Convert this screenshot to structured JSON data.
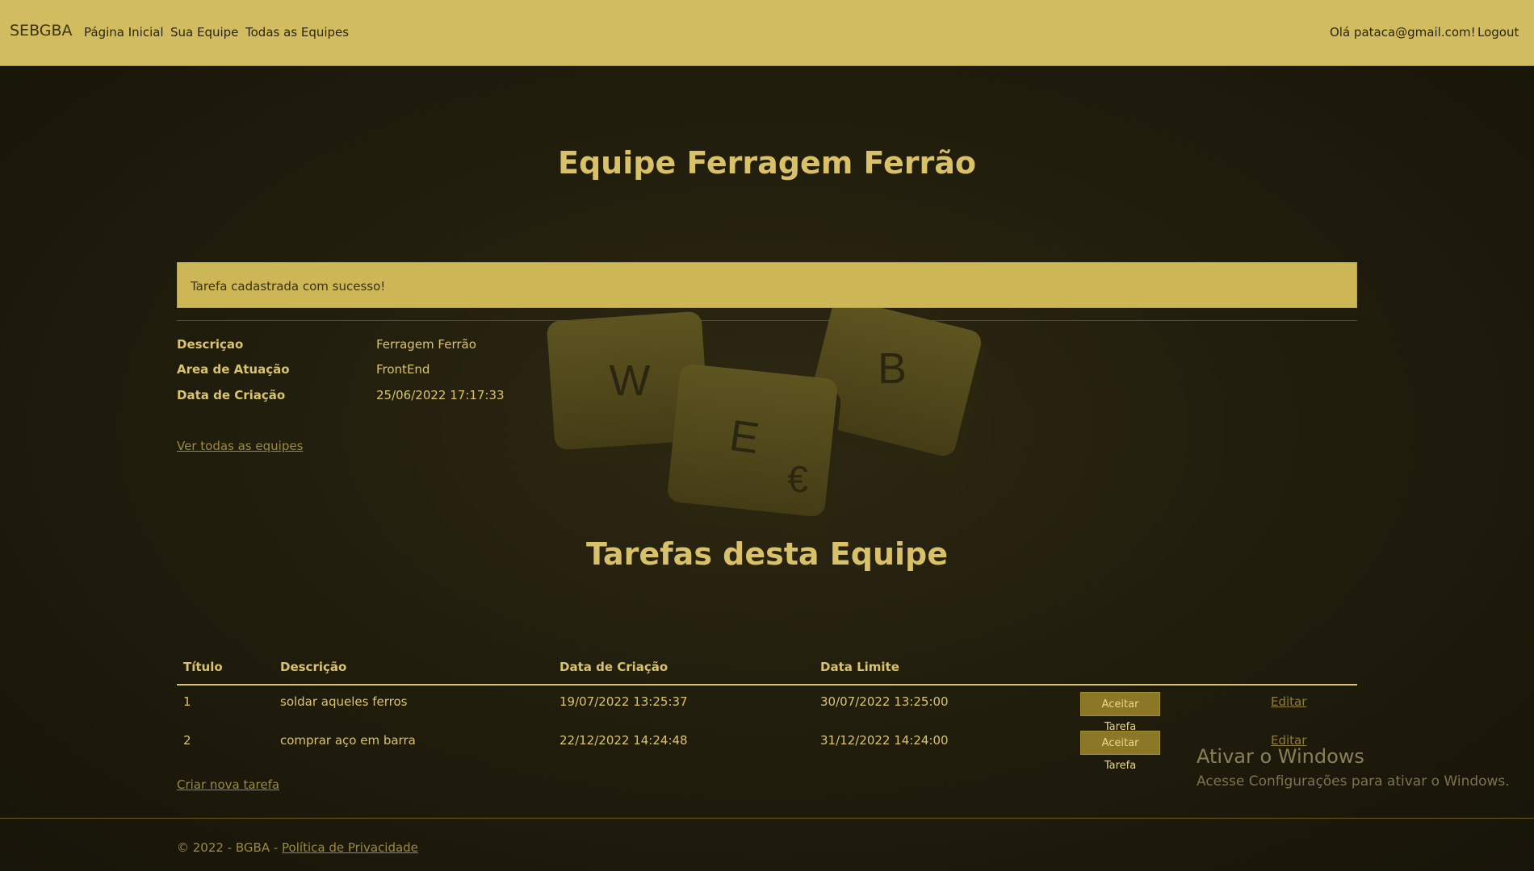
{
  "navbar": {
    "brand": "SEBGBA",
    "links": [
      "Página Inicial",
      "Sua Equipe",
      "Todas as Equipes"
    ],
    "greeting": "Olá pataca@gmail.com!",
    "logout": "Logout"
  },
  "page": {
    "title": "Equipe Ferragem Ferrão",
    "alert": "Tarefa cadastrada com sucesso!",
    "details": [
      {
        "term": "Descriçao",
        "value": "Ferragem Ferrão"
      },
      {
        "term": "Area de Atuação",
        "value": "FrontEnd"
      },
      {
        "term": "Data de Criação",
        "value": "25/06/2022 17:17:33"
      }
    ],
    "see_all_link": "Ver todas as equipes",
    "tasks_title": "Tarefas desta Equipe"
  },
  "tiles_image": {
    "letters": [
      "W",
      "B",
      "E",
      "€"
    ]
  },
  "tasks_table": {
    "headers": [
      "Título",
      "Descrição",
      "Data de Criação",
      "Data Limite"
    ],
    "rows": [
      {
        "titulo": "1",
        "descricao": "soldar aqueles ferros",
        "criacao": "19/07/2022 13:25:37",
        "limite": "30/07/2022 13:25:00",
        "accept": "Aceitar Tarefa",
        "edit": "Editar"
      },
      {
        "titulo": "2",
        "descricao": "comprar aço em barra",
        "criacao": "22/12/2022 14:24:48",
        "limite": "31/12/2022 14:24:00",
        "accept": "Aceitar Tarefa",
        "edit": "Editar"
      }
    ],
    "create_link": "Criar nova tarefa"
  },
  "footer": {
    "text": "© 2022 - BGBA - ",
    "privacy_link": "Política de Privacidade"
  },
  "windows_watermark": {
    "title": "Ativar o Windows",
    "subtitle": "Acesse Configurações para ativar o Windows."
  }
}
